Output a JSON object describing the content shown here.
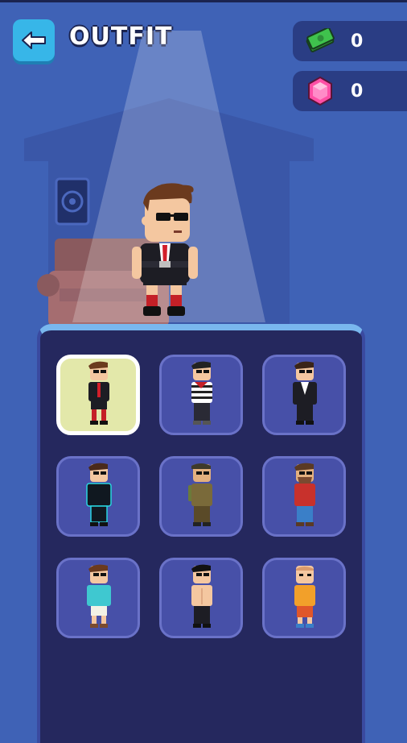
{
  "header": {
    "title": "OUTFIT",
    "back_icon": "arrow-left-icon"
  },
  "currency": [
    {
      "name": "cash",
      "icon": "cash-icon",
      "value": "0",
      "color": "#3fc24d"
    },
    {
      "name": "gems",
      "icon": "gem-icon",
      "value": "0",
      "color": "#ff4fa6"
    }
  ],
  "outfits": [
    {
      "name": "agent",
      "selected": true
    },
    {
      "name": "burglar",
      "selected": false
    },
    {
      "name": "suit",
      "selected": false
    },
    {
      "name": "neon",
      "selected": false
    },
    {
      "name": "soldier",
      "selected": false
    },
    {
      "name": "lumberjack",
      "selected": false
    },
    {
      "name": "tourist",
      "selected": false
    },
    {
      "name": "shirtless",
      "selected": false
    },
    {
      "name": "basketball",
      "selected": false
    }
  ],
  "colors": {
    "background": "#3f62b6",
    "panel": "#25285e",
    "slot": "#4750a8",
    "selected_slot": "#e3e8aa",
    "back_button": "#37b6e8"
  }
}
